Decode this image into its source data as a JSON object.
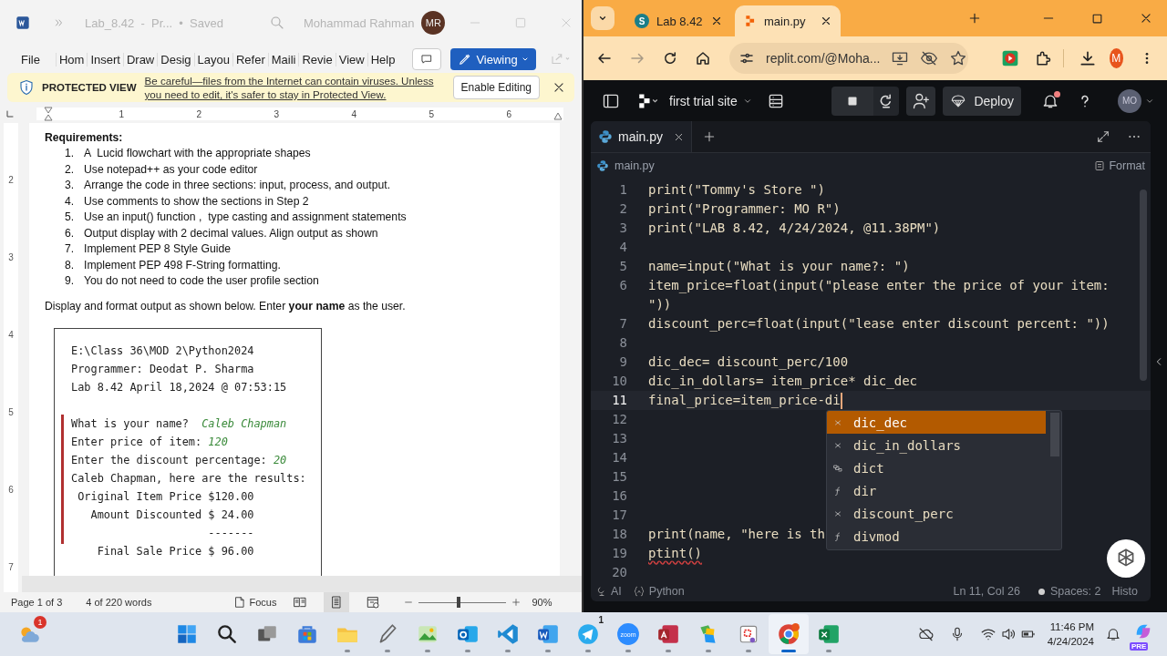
{
  "word": {
    "title_bar": {
      "title": "Lab_8.42  -  Pr...  •  Saved",
      "user": "Mohammad Rahman",
      "avatar": "MR"
    },
    "ribbon_tabs": [
      "File",
      "Hom",
      "Insert",
      "Draw",
      "Desig",
      "Layou",
      "Refer",
      "Maili",
      "Revie",
      "View",
      "Help"
    ],
    "mode_button": "Viewing",
    "protected_view": {
      "label": "PROTECTED VIEW",
      "message": "Be careful—files from the Internet can contain viruses. Unless you need to edit, it's safer to stay in Protected View.",
      "button": "Enable Editing"
    },
    "ruler": [
      "1",
      "2",
      "3",
      "4",
      "5",
      "6"
    ],
    "vertical_ruler": [
      "2",
      "3",
      "4",
      "5",
      "6",
      "7"
    ],
    "document": {
      "heading": "Requirements:",
      "requirements": [
        {
          "number": "1.",
          "text": "A  Lucid flowchart with the appropriate shapes"
        },
        {
          "number": "2.",
          "text": "Use notepad++ as your code editor"
        },
        {
          "number": "3.",
          "text": "Arrange the code in three sections: input, process, and output."
        },
        {
          "number": "4.",
          "text": "Use comments to show the sections in Step 2"
        },
        {
          "number": "5.",
          "text": "Use an input() function ,  type casting and assignment statements"
        },
        {
          "number": "6.",
          "text": "Output display with 2 decimal values. Align output as shown"
        },
        {
          "number": "7.",
          "text": "Implement PEP 8 Style Guide"
        },
        {
          "number": "8.",
          "text": "Implement PEP 498 F-String formatting."
        },
        {
          "number": "9.",
          "text": "You do not need to code the user profile section"
        }
      ],
      "paragraph": "Display and format output as shown below. Enter **your name** as the user.",
      "console": {
        "header": [
          "E:\\Class 36\\MOD 2\\Python2024",
          "Programmer: Deodat P. Sharma",
          "Lab 8.42 April 18,2024 @ 07:53:15"
        ],
        "lines": [
          {
            "text": "What is your name?  ",
            "input": "Caleb Chapman"
          },
          {
            "text": "Enter price of item: ",
            "input": "120"
          },
          {
            "text": "Enter the discount percentage: ",
            "input": "20"
          },
          {
            "text": "Caleb Chapman, here are the results:"
          },
          {
            "text": " Original Item Price $120.00"
          },
          {
            "text": "   Amount Discounted $ 24.00"
          },
          {
            "text": "                     -------"
          },
          {
            "text": "    Final Sale Price $ 96.00"
          }
        ]
      }
    },
    "status_bar": {
      "page": "Page 1 of 3",
      "words": "4 of 220 words",
      "focus": "Focus",
      "views": [
        {
          "kind": "read",
          "selected": false
        },
        {
          "kind": "print",
          "selected": true
        },
        {
          "kind": "web",
          "selected": false
        }
      ],
      "zoom": {
        "level": 0.45,
        "reading": "90%"
      }
    }
  },
  "browser": {
    "tabs": [
      {
        "title": "Lab 8.42",
        "icon_letter": "S",
        "selected": false
      },
      {
        "title": "main.py",
        "selected": true
      }
    ],
    "forward_disabled": true,
    "address": "replit.com/@Moha...",
    "profile": "M",
    "replit": {
      "project": "first trial site",
      "deploy": "Deploy",
      "notification": true,
      "avatar": "MO"
    },
    "editor": {
      "tab": "main.py",
      "breadcrumb": "main.py",
      "format": "Format",
      "lines": [
        {
          "number": "1",
          "text": "print(\"Tommy's Store \")",
          "active": false,
          "error": false
        },
        {
          "number": "2",
          "text": "print(\"Programmer: MO R\")",
          "active": false,
          "error": false
        },
        {
          "number": "3",
          "text": "print(\"LAB 8.42, 4/24/2024, @11.38PM\")",
          "active": false,
          "error": false
        },
        {
          "number": "4",
          "active": false
        },
        {
          "number": "5",
          "text": "name=input(\"What is your name?: \")",
          "active": false,
          "error": false
        },
        {
          "number": "6",
          "text": "item_price=float(input(\"please enter the price of your item: \"))",
          "active": false,
          "error": false
        },
        {
          "number": "7",
          "text": "discount_perc=float(input(\"lease enter discount percent: \"))",
          "active": false,
          "error": false
        },
        {
          "number": "8",
          "active": false
        },
        {
          "number": "9",
          "text": "dic_dec= discount_perc/100",
          "active": false,
          "error": false
        },
        {
          "number": "10",
          "text": "dic_in_dollars= item_price* dic_dec",
          "active": false,
          "error": false
        },
        {
          "number": "11",
          "text": "final_price=item_price-di",
          "active": true,
          "error": false
        },
        {
          "number": "12",
          "active": false
        },
        {
          "number": "13",
          "active": false
        },
        {
          "number": "14",
          "active": false
        },
        {
          "number": "15",
          "active": false
        },
        {
          "number": "16",
          "active": false
        },
        {
          "number": "17",
          "active": false
        },
        {
          "number": "18",
          "text": "print(name, \"here is th",
          "active": false,
          "error": false
        },
        {
          "number": "19",
          "text": "ptint()",
          "active": false,
          "error": true
        },
        {
          "number": "20",
          "active": false
        }
      ],
      "autocomplete": [
        {
          "kind": "variable",
          "label": "dic_dec",
          "selected": true
        },
        {
          "kind": "variable",
          "label": "dic_in_dollars",
          "selected": false
        },
        {
          "kind": "class",
          "label": "dict",
          "selected": false
        },
        {
          "kind": "function",
          "label": "dir",
          "selected": false
        },
        {
          "kind": "variable",
          "label": "discount_perc",
          "selected": false
        },
        {
          "kind": "function",
          "label": "divmod",
          "selected": false
        }
      ],
      "status": {
        "ai": "AI",
        "language": "Python",
        "position": "Ln 11, Col 26",
        "spaces": "Spaces: 2",
        "history": "Histo"
      }
    }
  },
  "taskbar": {
    "weather_badge": "1",
    "apps": [
      {
        "kind": "start",
        "running": false,
        "selected": false
      },
      {
        "kind": "search",
        "running": false,
        "selected": false
      },
      {
        "kind": "taskview",
        "running": false,
        "selected": false
      },
      {
        "kind": "store",
        "running": false,
        "selected": false
      },
      {
        "kind": "folder",
        "running": true,
        "selected": false
      },
      {
        "kind": "pen",
        "running": true,
        "selected": false
      },
      {
        "kind": "photo",
        "running": true,
        "selected": false
      },
      {
        "kind": "mail",
        "running": true,
        "selected": false
      },
      {
        "kind": "code",
        "running": true,
        "selected": false
      },
      {
        "kind": "document",
        "running": true,
        "selected": false
      },
      {
        "kind": "plane",
        "running": true,
        "selected": false,
        "badge": "1"
      },
      {
        "kind": "zoom",
        "label": "zoom",
        "running": true,
        "selected": false
      },
      {
        "kind": "database",
        "running": true,
        "selected": false
      },
      {
        "kind": "palette",
        "running": true,
        "selected": false
      },
      {
        "kind": "snip",
        "running": true,
        "selected": false
      },
      {
        "kind": "browser",
        "running": true,
        "selected": true
      },
      {
        "kind": "sheet",
        "running": true,
        "selected": false
      }
    ],
    "time": "11:46 PM",
    "date": "4/24/2024",
    "copilot_badge": "PRE"
  }
}
